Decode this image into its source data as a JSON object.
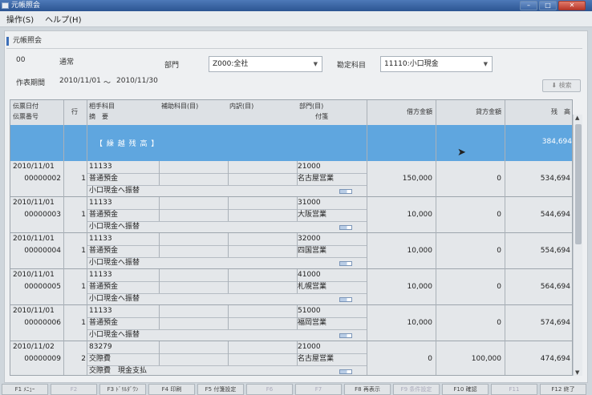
{
  "window": {
    "title": "元帳照会"
  },
  "menu": [
    "操作(S)",
    "ヘルプ(H)"
  ],
  "section_title": "元帳照会",
  "form": {
    "code": "00",
    "type": "通常",
    "dept_label": "部門",
    "dept_value": "Z000:全社",
    "account_label": "勘定科目",
    "account_value": "11110:小口現金",
    "period_label": "作表期間",
    "period_from": "2010/11/01",
    "period_sep": "～",
    "period_to": "2010/11/30",
    "search_label": "検索"
  },
  "grid": {
    "headers": {
      "date": "伝票日付",
      "voucher_no": "伝票番号",
      "line": "行",
      "contra": "相手科目",
      "memo": "摘　要",
      "sub": "補助科目(目)",
      "detail": "内訳(目)",
      "dept": "部門(目)",
      "tag": "付箋",
      "debit": "借方金額",
      "credit": "貸方金額",
      "balance": "残　高"
    },
    "carry_forward": {
      "label": "【 繰 越 残 高 】",
      "balance": "384,694"
    },
    "rows": [
      {
        "date": "2010/11/01",
        "no": "00000002",
        "line": "1",
        "acct_code": "11133",
        "acct_name": "普通預金",
        "memo": "小口現金へ振替",
        "dept_code": "21000",
        "dept_name": "名古屋営業",
        "debit": "150,000",
        "credit": "0",
        "balance": "534,694"
      },
      {
        "date": "2010/11/01",
        "no": "00000003",
        "line": "1",
        "acct_code": "11133",
        "acct_name": "普通預金",
        "memo": "小口現金へ振替",
        "dept_code": "31000",
        "dept_name": "大阪営業",
        "debit": "10,000",
        "credit": "0",
        "balance": "544,694"
      },
      {
        "date": "2010/11/01",
        "no": "00000004",
        "line": "1",
        "acct_code": "11133",
        "acct_name": "普通預金",
        "memo": "小口現金へ振替",
        "dept_code": "32000",
        "dept_name": "四国営業",
        "debit": "10,000",
        "credit": "0",
        "balance": "554,694"
      },
      {
        "date": "2010/11/01",
        "no": "00000005",
        "line": "1",
        "acct_code": "11133",
        "acct_name": "普通預金",
        "memo": "小口現金へ振替",
        "dept_code": "41000",
        "dept_name": "札幌営業",
        "debit": "10,000",
        "credit": "0",
        "balance": "564,694"
      },
      {
        "date": "2010/11/01",
        "no": "00000006",
        "line": "1",
        "acct_code": "11133",
        "acct_name": "普通預金",
        "memo": "小口現金へ振替",
        "dept_code": "51000",
        "dept_name": "福岡営業",
        "debit": "10,000",
        "credit": "0",
        "balance": "574,694"
      },
      {
        "date": "2010/11/02",
        "no": "00000009",
        "line": "2",
        "acct_code": "83279",
        "acct_name": "交際費",
        "memo": "交際費　現金支払",
        "dept_code": "21000",
        "dept_name": "名古屋営業",
        "debit": "0",
        "credit": "100,000",
        "balance": "474,694"
      }
    ]
  },
  "fkeys": [
    {
      "label": "F1 ﾒﾆｭｰ",
      "enabled": true
    },
    {
      "label": "F2",
      "enabled": false
    },
    {
      "label": "F3 ﾄﾞﾘﾙﾀﾞｳﾝ",
      "enabled": true
    },
    {
      "label": "F4 印刷",
      "enabled": true
    },
    {
      "label": "F5 付箋設定",
      "enabled": true
    },
    {
      "label": "F6",
      "enabled": false
    },
    {
      "label": "F7",
      "enabled": false
    },
    {
      "label": "F8 再表示",
      "enabled": true
    },
    {
      "label": "F9 条件設定",
      "enabled": false
    },
    {
      "label": "F10 確認",
      "enabled": true
    },
    {
      "label": "F11",
      "enabled": false
    },
    {
      "label": "F12 終了",
      "enabled": true
    }
  ]
}
